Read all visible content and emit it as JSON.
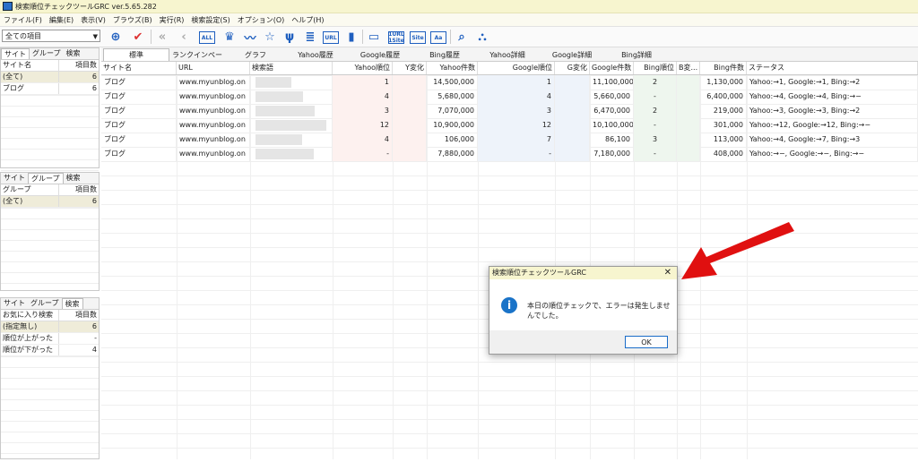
{
  "window": {
    "title": "検索順位チェックツールGRC  ver.5.65.282"
  },
  "menu": [
    "ファイル(F)",
    "編集(E)",
    "表示(V)",
    "ブラウズ(B)",
    "実行(R)",
    "検索設定(S)",
    "オプション(O)",
    "ヘルプ(H)"
  ],
  "toolbar": {
    "filter_value": "全ての項目",
    "all_label": "ALL",
    "url_label": "URL",
    "site1_label": "1URL\n1Site",
    "site_label": "Site",
    "aa_label": "Aa"
  },
  "panel_site": {
    "tabs": [
      "サイト",
      "グループ",
      "検索"
    ],
    "headers": [
      "サイト名",
      "項目数"
    ],
    "rows": [
      {
        "name": "(全て)",
        "count": "6"
      },
      {
        "name": "ブログ",
        "count": "6"
      }
    ]
  },
  "panel_group": {
    "tabs": [
      "サイト",
      "グループ",
      "検索"
    ],
    "headers": [
      "グループ",
      "項目数"
    ],
    "rows": [
      {
        "name": "(全て)",
        "count": "6"
      }
    ]
  },
  "panel_search": {
    "tabs": [
      "サイト",
      "グループ",
      "検索"
    ],
    "headers": [
      "お気に入り検索",
      "項目数"
    ],
    "rows": [
      {
        "name": "(指定無し)",
        "count": "6"
      },
      {
        "name": "順位が上がった",
        "count": "-"
      },
      {
        "name": "順位が下がった",
        "count": "4"
      }
    ]
  },
  "main_tabs": [
    "標準",
    "ランクインページ",
    "グラフ",
    "Yahoo履歴",
    "Google履歴",
    "Bing履歴",
    "Yahoo詳細",
    "Google詳細",
    "Bing詳細"
  ],
  "columns": [
    "サイト名",
    "URL",
    "検索語",
    "Yahoo順位",
    "Y変化",
    "Yahoo件数",
    "Google順位",
    "G変化",
    "Google件数",
    "Bing順位",
    "B変...",
    "Bing件数",
    "ステータス"
  ],
  "rows": [
    {
      "site": "ブログ",
      "url": "www.myunblog.on",
      "yrank": "1",
      "ycount": "14,500,000",
      "grank": "1",
      "gcount": "11,100,000",
      "brank": "2",
      "bcount": "1,130,000",
      "status": "Yahoo:→1, Google:→1, Bing:→2"
    },
    {
      "site": "ブログ",
      "url": "www.myunblog.on",
      "yrank": "4",
      "ycount": "5,680,000",
      "grank": "4",
      "gcount": "5,660,000",
      "brank": "-",
      "bcount": "6,400,000",
      "status": "Yahoo:→4, Google:→4, Bing:→−"
    },
    {
      "site": "ブログ",
      "url": "www.myunblog.on",
      "yrank": "3",
      "ycount": "7,070,000",
      "grank": "3",
      "gcount": "6,470,000",
      "brank": "2",
      "bcount": "219,000",
      "status": "Yahoo:→3, Google:→3, Bing:→2"
    },
    {
      "site": "ブログ",
      "url": "www.myunblog.on",
      "yrank": "12",
      "ycount": "10,900,000",
      "grank": "12",
      "gcount": "10,100,000",
      "brank": "-",
      "bcount": "301,000",
      "status": "Yahoo:→12, Google:→12, Bing:→−"
    },
    {
      "site": "ブログ",
      "url": "www.myunblog.on",
      "yrank": "4",
      "ycount": "106,000",
      "grank": "7",
      "gcount": "86,100",
      "brank": "3",
      "bcount": "113,000",
      "status": "Yahoo:→4, Google:→7, Bing:→3"
    },
    {
      "site": "ブログ",
      "url": "www.myunblog.on",
      "yrank": "-",
      "ycount": "7,880,000",
      "grank": "-",
      "gcount": "7,180,000",
      "brank": "-",
      "bcount": "408,000",
      "status": "Yahoo:→−, Google:→−, Bing:→−"
    }
  ],
  "dialog": {
    "title": "検索順位チェックツールGRC",
    "message": "本日の順位チェックで、エラーは発生しませんでした。",
    "ok_label": "OK"
  },
  "colors": {
    "accent": "#1f5fbf",
    "arrow": "#e01010",
    "titlebar": "#f7f5cf"
  }
}
